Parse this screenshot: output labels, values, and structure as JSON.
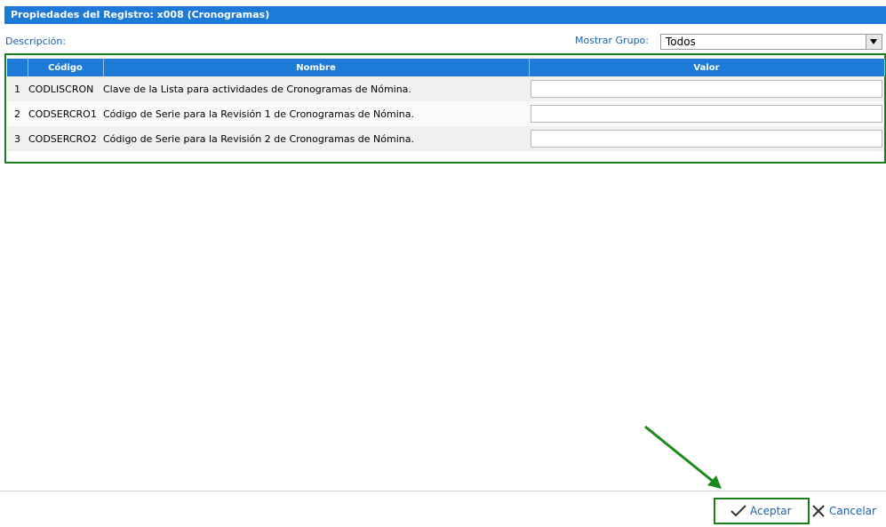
{
  "window": {
    "title": "Propiedades del Registro: x008 (Cronogramas)"
  },
  "filters": {
    "description_label": "Descripción:",
    "group_label": "Mostrar Grupo:",
    "group_value": "Todos"
  },
  "grid": {
    "columns": {
      "code": "Código",
      "name": "Nombre",
      "value": "Valor"
    },
    "rows": [
      {
        "num": "1",
        "code": "CODLISCRON",
        "name": "Clave de la Lista para actividades de Cronogramas de Nómina.",
        "value": ""
      },
      {
        "num": "2",
        "code": "CODSERCRO1",
        "name": "Código de Serie para la Revisión 1 de Cronogramas de Nómina.",
        "value": ""
      },
      {
        "num": "3",
        "code": "CODSERCRO2",
        "name": "Código de Serie para la Revisión 2 de Cronogramas de Nómina.",
        "value": ""
      }
    ]
  },
  "footer": {
    "accept_label": "Aceptar",
    "cancel_label": "Cancelar",
    "accept_icon": "check-icon",
    "cancel_icon": "close-icon"
  },
  "colors": {
    "accent": "#1d7ad6",
    "highlight": "#1a7d1a",
    "link": "#1a5fae"
  }
}
